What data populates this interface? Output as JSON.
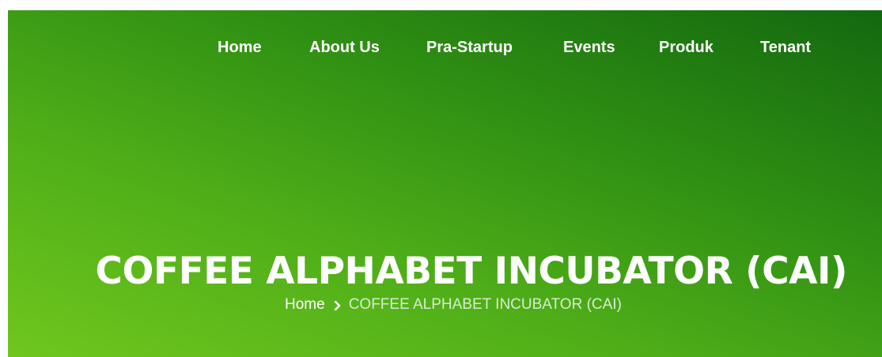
{
  "nav": {
    "items": [
      {
        "label": "Home"
      },
      {
        "label": "About Us"
      },
      {
        "label": "Pra-Startup"
      },
      {
        "label": "Events"
      },
      {
        "label": "Produk"
      },
      {
        "label": "Tenant"
      }
    ]
  },
  "hero": {
    "title": "COFFEE ALPHABET INCUBATOR (CAI)"
  },
  "breadcrumb": {
    "home_label": "Home",
    "separator_icon": "chevron-right-icon",
    "current_label": "COFFEE ALPHABET INCUBATOR (CAI)"
  },
  "colors": {
    "gradient_dark": "#13680f",
    "gradient_light": "#6fc61e",
    "text": "#ffffff"
  }
}
